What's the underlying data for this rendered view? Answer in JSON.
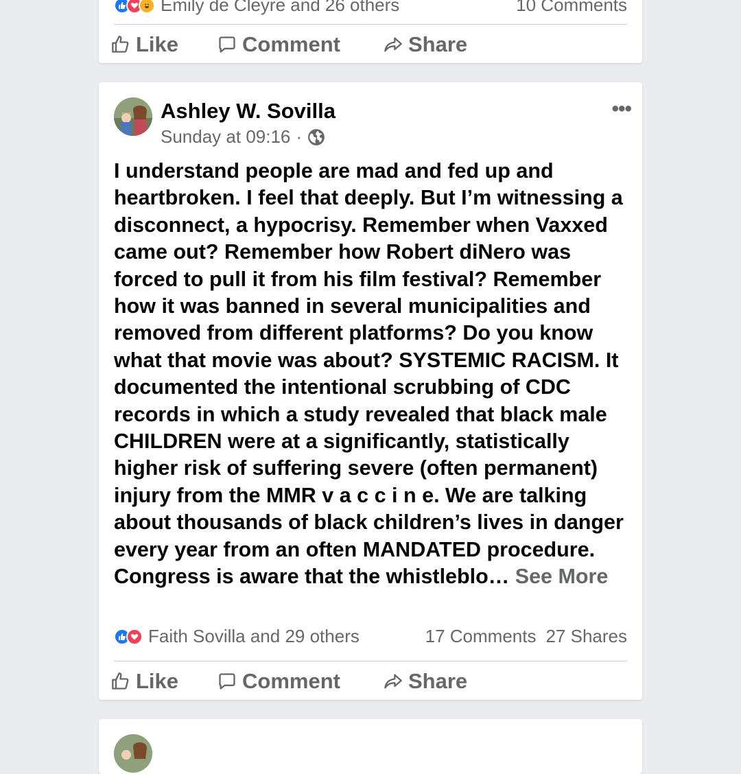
{
  "previous_post": {
    "reactions_text": "Emily de Cleyre and 26 others",
    "comments": "10 Comments",
    "actions": {
      "like": "Like",
      "comment": "Comment",
      "share": "Share"
    }
  },
  "post": {
    "author": "Ashley W. Sovilla",
    "timestamp": "Sunday at 09:16",
    "separator": "·",
    "privacy_icon": "globe-icon",
    "more_icon": "more-options-icon",
    "more_label": "•••",
    "text": "I understand people are mad and fed up and heartbroken. I feel that deeply. But I’m witnessing a disconnect, a hypocrisy. Remember when Vaxxed came out? Remember how Robert diNero was forced to pull it from his film festival? Remember how it was banned in several municipalities and removed from different platforms? Do you know what that movie was about? SYSTEMIC RACISM. It documented the intentional scrubbing of CDC records in which a study revealed that black male CHILDREN were at a significantly, statistically higher risk of suffering severe (often permanent) injury from the MMR v a c c i n e. We are talking about thousands of black children’s lives in danger every year from an often MANDATED procedure. Congress is aware that the whistleblo…",
    "see_more": "See More",
    "reactions_text": "Faith Sovilla and 29 others",
    "comments": "17 Comments",
    "shares": "27 Shares",
    "actions": {
      "like": "Like",
      "comment": "Comment",
      "share": "Share"
    }
  },
  "colors": {
    "background": "#e9ebee",
    "card": "#ffffff",
    "secondary_text": "#65676b",
    "like_blue": "#1877f2",
    "love_red": "#f33e58",
    "haha_yellow": "#f7b125"
  }
}
